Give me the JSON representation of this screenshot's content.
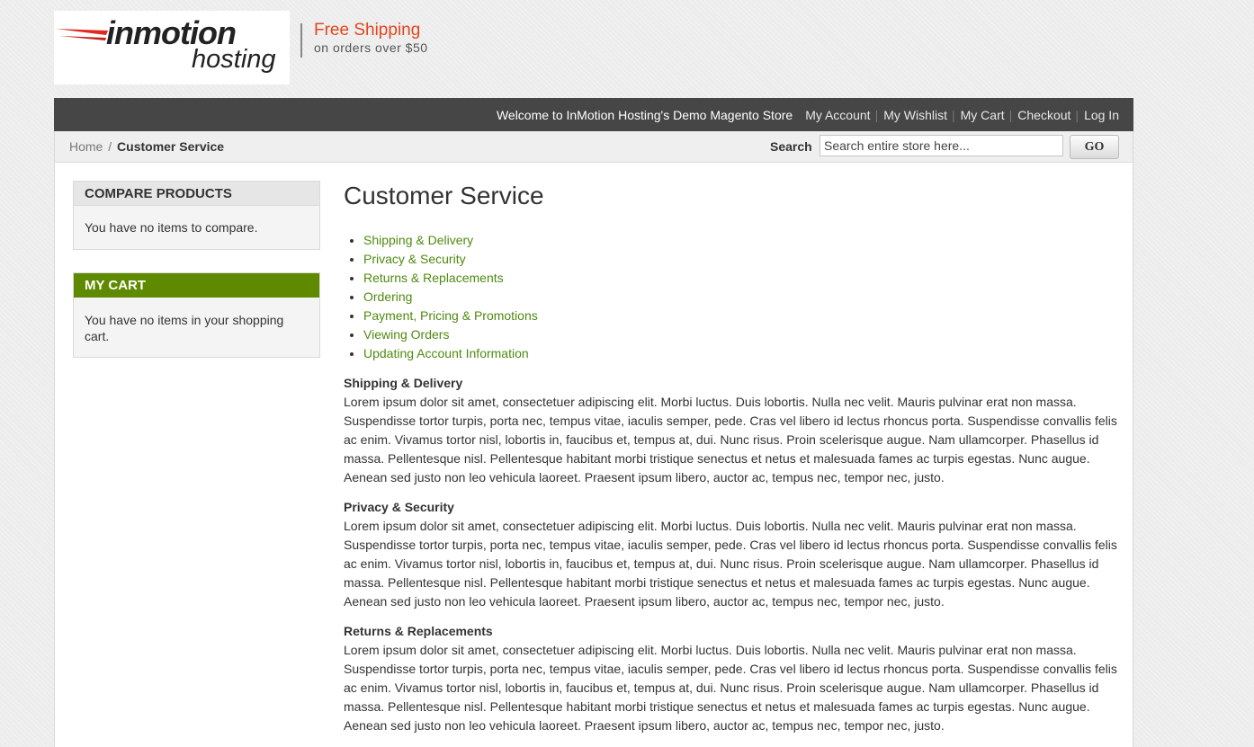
{
  "header": {
    "logo_main": "inmotion",
    "logo_sub": "hosting",
    "promo_title": "Free Shipping",
    "promo_sub": "on orders over $50"
  },
  "topbar": {
    "welcome": "Welcome to InMotion Hosting's Demo Magento Store",
    "links": [
      "My Account",
      "My Wishlist",
      "My Cart",
      "Checkout",
      "Log In"
    ]
  },
  "breadcrumb": {
    "home": "Home",
    "separator": "/",
    "current": "Customer Service"
  },
  "search": {
    "label": "Search",
    "placeholder": "Search entire store here...",
    "button": "GO"
  },
  "sidebar": {
    "compare": {
      "title": "COMPARE PRODUCTS",
      "text": "You have no items to compare."
    },
    "cart": {
      "title": "MY CART",
      "text": "You have no items in your shopping cart."
    }
  },
  "main": {
    "title": "Customer Service",
    "toc": [
      "Shipping & Delivery",
      "Privacy & Security",
      "Returns & Replacements",
      "Ordering",
      "Payment, Pricing & Promotions",
      "Viewing Orders",
      "Updating Account Information"
    ],
    "sections": [
      {
        "heading": "Shipping & Delivery",
        "body": "Lorem ipsum dolor sit amet, consectetuer adipiscing elit. Morbi luctus. Duis lobortis. Nulla nec velit. Mauris pulvinar erat non massa. Suspendisse tortor turpis, porta nec, tempus vitae, iaculis semper, pede. Cras vel libero id lectus rhoncus porta. Suspendisse convallis felis ac enim. Vivamus tortor nisl, lobortis in, faucibus et, tempus at, dui. Nunc risus. Proin scelerisque augue. Nam ullamcorper. Phasellus id massa. Pellentesque nisl. Pellentesque habitant morbi tristique senectus et netus et malesuada fames ac turpis egestas. Nunc augue. Aenean sed justo non leo vehicula laoreet. Praesent ipsum libero, auctor ac, tempus nec, tempor nec, justo."
      },
      {
        "heading": "Privacy & Security",
        "body": "Lorem ipsum dolor sit amet, consectetuer adipiscing elit. Morbi luctus. Duis lobortis. Nulla nec velit. Mauris pulvinar erat non massa. Suspendisse tortor turpis, porta nec, tempus vitae, iaculis semper, pede. Cras vel libero id lectus rhoncus porta. Suspendisse convallis felis ac enim. Vivamus tortor nisl, lobortis in, faucibus et, tempus at, dui. Nunc risus. Proin scelerisque augue. Nam ullamcorper. Phasellus id massa. Pellentesque nisl. Pellentesque habitant morbi tristique senectus et netus et malesuada fames ac turpis egestas. Nunc augue. Aenean sed justo non leo vehicula laoreet. Praesent ipsum libero, auctor ac, tempus nec, tempor nec, justo."
      },
      {
        "heading": "Returns & Replacements",
        "body": "Lorem ipsum dolor sit amet, consectetuer adipiscing elit. Morbi luctus. Duis lobortis. Nulla nec velit. Mauris pulvinar erat non massa. Suspendisse tortor turpis, porta nec, tempus vitae, iaculis semper, pede. Cras vel libero id lectus rhoncus porta. Suspendisse convallis felis ac enim. Vivamus tortor nisl, lobortis in, faucibus et, tempus at, dui. Nunc risus. Proin scelerisque augue. Nam ullamcorper. Phasellus id massa. Pellentesque nisl. Pellentesque habitant morbi tristique senectus et netus et malesuada fames ac turpis egestas. Nunc augue. Aenean sed justo non leo vehicula laoreet. Praesent ipsum libero, auctor ac, tempus nec, tempor nec, justo."
      }
    ]
  },
  "colors": {
    "accent_green": "#5f8a00",
    "link_green": "#4f8a10",
    "topbar_bg": "#464646",
    "promo_orange": "#e2461f"
  },
  "icons": [
    "inmotion-logo-swoosh-icon"
  ]
}
